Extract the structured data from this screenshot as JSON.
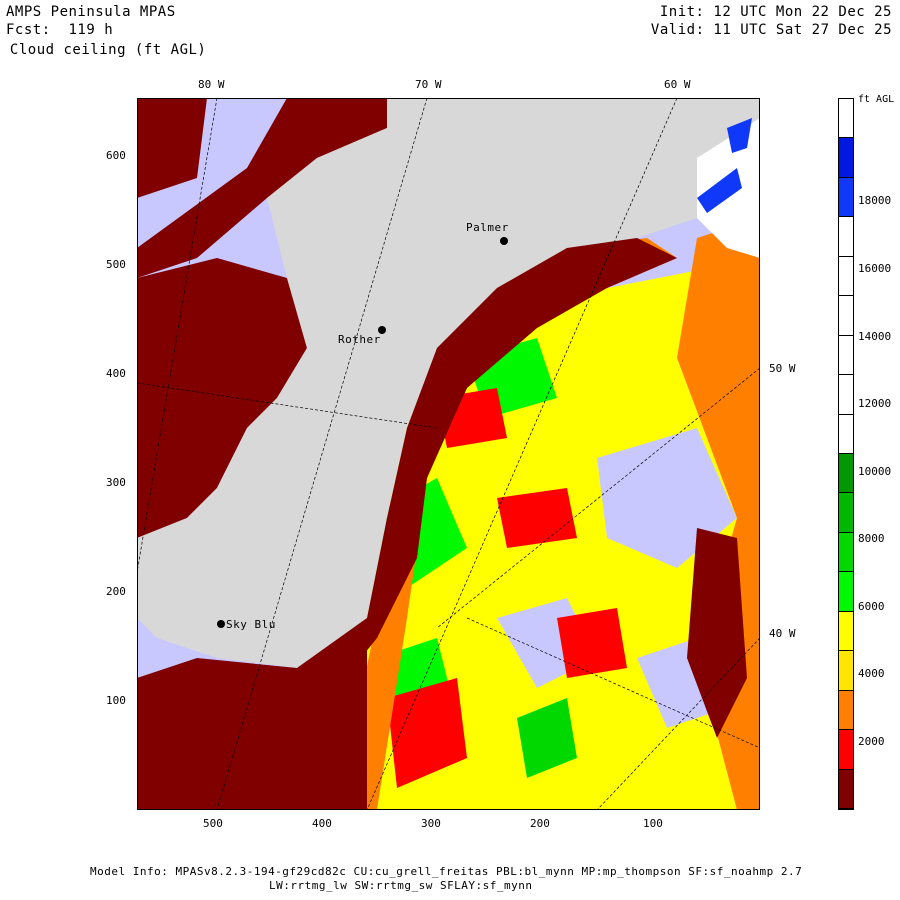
{
  "header": {
    "line1_left": "AMPS Peninsula MPAS",
    "line2_left": "Fcst:  119 h",
    "line3_left": " Cloud ceiling (ft AGL)",
    "line1_right": "Init: 12 UTC Mon 22 Dec 25",
    "line2_right": "Valid: 11 UTC Sat 27 Dec 25"
  },
  "lon_labels_top": [
    "80 W",
    "70 W",
    "60 W"
  ],
  "lon_labels_right": [
    "50 W",
    "40 W"
  ],
  "y_ticks": [
    "600",
    "500",
    "400",
    "300",
    "200",
    "100"
  ],
  "x_ticks": [
    "500",
    "400",
    "300",
    "200",
    "100"
  ],
  "stations": [
    "Palmer",
    "Rother",
    "Sky Blu"
  ],
  "colorbar": {
    "unit": "ft AGL",
    "labels": [
      "18000",
      "16000",
      "14000",
      "12000",
      "10000",
      "8000",
      "6000",
      "4000",
      "2000"
    ],
    "colors": [
      "#ffffff",
      "#0018e0",
      "#1038f8",
      "#ffffff",
      "#ffffff",
      "#ffffff",
      "#ffffff",
      "#ffffff",
      "#ffffff",
      "#009800",
      "#00b800",
      "#00d800",
      "#00f800",
      "#ffff00",
      "#ffe600",
      "#ff8000",
      "#ff0000",
      "#800000"
    ]
  },
  "footer": {
    "line1": "Model Info: MPASv8.2.3-194-gf29cd82c CU:cu_grell_freitas PBL:bl_mynn MP:mp_thompson SF:sf_noahmp 2.7",
    "line2": "LW:rrtmg_lw SW:rrtmg_sw SFLAY:sf_mynn"
  }
}
